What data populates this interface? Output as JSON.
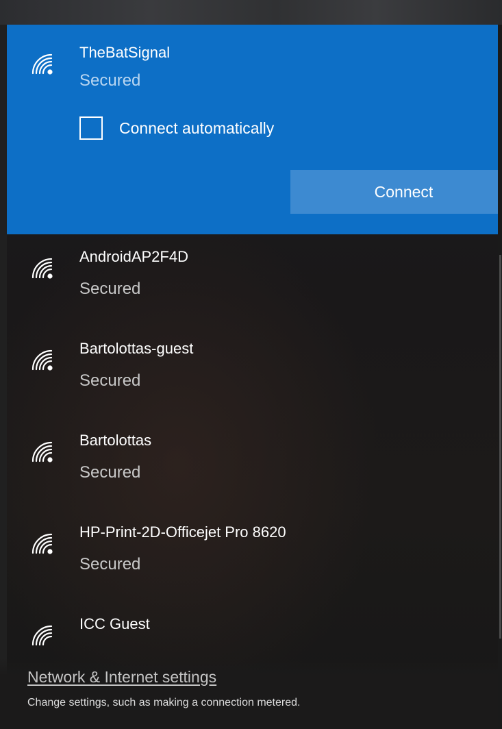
{
  "selected_network": {
    "name": "TheBatSignal",
    "status": "Secured",
    "icon": "wifi-secured-icon",
    "connect_automatically_label": "Connect automatically",
    "connect_automatically_checked": false,
    "connect_label": "Connect"
  },
  "networks": [
    {
      "name": "AndroidAP2F4D",
      "status": "Secured",
      "icon": "wifi-secured-icon"
    },
    {
      "name": "Bartolottas-guest",
      "status": "Secured",
      "icon": "wifi-secured-icon"
    },
    {
      "name": "Bartolottas",
      "status": "Secured",
      "icon": "wifi-secured-icon"
    },
    {
      "name": "HP-Print-2D-Officejet Pro 8620",
      "status": "Secured",
      "icon": "wifi-secured-icon"
    },
    {
      "name": "ICC Guest",
      "status": "",
      "icon": "wifi-open-icon"
    }
  ],
  "footer": {
    "settings_link": "Network & Internet settings",
    "settings_description": "Change settings, such as making a connection metered."
  },
  "colors": {
    "accent": "#0d6fc6",
    "button": "#3d8ad1",
    "panel_background": "#1b1a1a",
    "secondary_text": "#c8c8c8"
  }
}
